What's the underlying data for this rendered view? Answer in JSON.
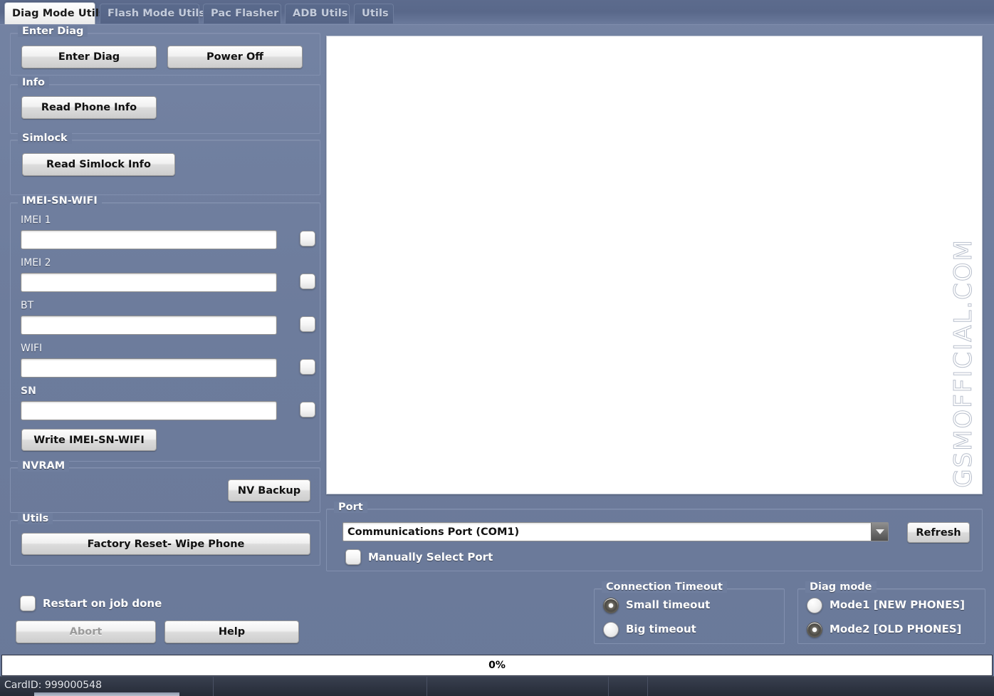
{
  "tabs": [
    {
      "label": "Diag Mode Utils",
      "active": true
    },
    {
      "label": "Flash Mode Utils",
      "active": false
    },
    {
      "label": "Pac Flasher",
      "active": false
    },
    {
      "label": "ADB Utils",
      "active": false
    },
    {
      "label": "Utils",
      "active": false
    }
  ],
  "groups": {
    "enter_diag": {
      "title": "Enter Diag",
      "enter_diag_button": "Enter Diag",
      "power_off_button": "Power Off"
    },
    "info": {
      "title": "Info",
      "read_phone_info_button": "Read Phone Info"
    },
    "simlock": {
      "title": "Simlock",
      "read_simlock_info_button": "Read Simlock Info"
    },
    "imei": {
      "title": "IMEI-SN-WIFI",
      "fields": [
        {
          "label": "IMEI 1",
          "value": "",
          "checked": false
        },
        {
          "label": "IMEI 2",
          "value": "",
          "checked": false
        },
        {
          "label": "BT",
          "value": "",
          "checked": false
        },
        {
          "label": "WIFI",
          "value": "",
          "checked": false
        },
        {
          "label": "SN",
          "value": "",
          "checked": false
        }
      ],
      "write_button": "Write IMEI-SN-WIFI"
    },
    "nvram": {
      "title": "NVRAM",
      "nv_backup_button": "NV Backup"
    },
    "utils": {
      "title": "Utils",
      "factory_reset_button": "Factory Reset- Wipe Phone"
    },
    "port": {
      "title": "Port",
      "selected_port": "Communications Port (COM1)",
      "refresh_button": "Refresh",
      "manual_select_label": "Manually Select Port",
      "manual_select_checked": false
    },
    "connection_timeout": {
      "title": "Connection Timeout",
      "options": [
        {
          "label": "Small timeout",
          "selected": true
        },
        {
          "label": "Big timeout",
          "selected": false
        }
      ]
    },
    "diag_mode": {
      "title": "Diag mode",
      "options": [
        {
          "label": "Mode1  [NEW PHONES]",
          "selected": false
        },
        {
          "label": "Mode2 [OLD PHONES]",
          "selected": true
        }
      ]
    }
  },
  "footer": {
    "restart_label": "Restart on job done",
    "restart_checked": false,
    "abort_button": "Abort",
    "abort_disabled": true,
    "help_button": "Help"
  },
  "log": {
    "text": "",
    "watermark": "GSMOFFICIAL.COM"
  },
  "progress": {
    "percent_label": "0%",
    "percent_value": 0
  },
  "statusbar": {
    "card_id": "CardID: 999000548"
  },
  "colors": {
    "background": "#6f7e9e",
    "panel": "#ffffff",
    "tab_active_bg": "#ffffff",
    "status_bar": "#2e3442",
    "watermark": "#b8bfcc"
  }
}
